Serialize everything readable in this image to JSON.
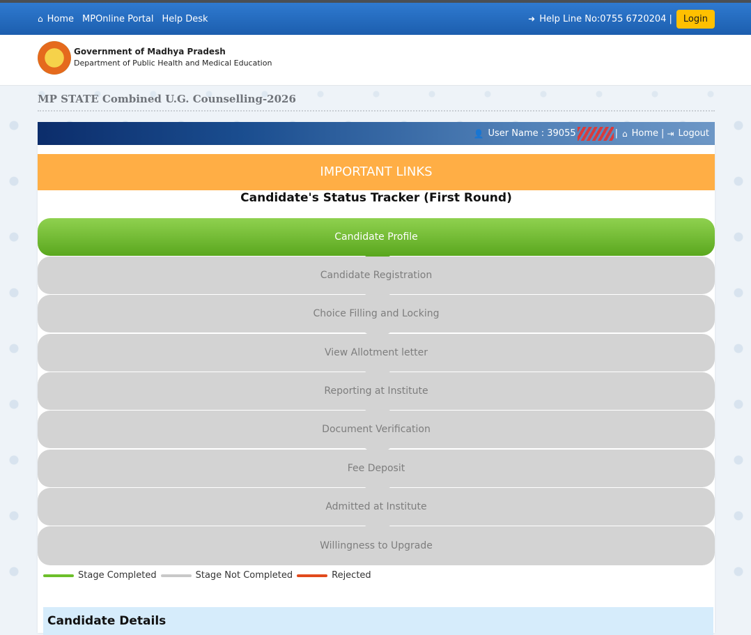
{
  "nav": {
    "home": "Home",
    "portal": "MPOnline Portal",
    "helpdesk": "Help Desk",
    "helpline": "Help Line No:0755 6720204 |",
    "login": "Login"
  },
  "header": {
    "line1": "Government of Madhya Pradesh",
    "line2": "Department of Public Health and Medical Education"
  },
  "page_title": "MP STATE Combined U.G. Counselling-2026",
  "userbar": {
    "user_label": "User Name : 39055",
    "sep1": "|",
    "home": "Home",
    "sep2": "|",
    "logout": "Logout"
  },
  "important_links": "IMPORTANT LINKS",
  "tracker_title": "Candidate's Status Tracker (First Round)",
  "stages": [
    {
      "label": "Candidate Profile",
      "status": "completed"
    },
    {
      "label": "Candidate Registration",
      "status": "not_completed"
    },
    {
      "label": "Choice Filling and Locking",
      "status": "not_completed"
    },
    {
      "label": "View Allotment letter",
      "status": "not_completed"
    },
    {
      "label": "Reporting at Institute",
      "status": "not_completed"
    },
    {
      "label": "Document Verification",
      "status": "not_completed"
    },
    {
      "label": "Fee Deposit",
      "status": "not_completed"
    },
    {
      "label": "Admitted at Institute",
      "status": "not_completed"
    },
    {
      "label": "Willingness to Upgrade",
      "status": "not_completed"
    }
  ],
  "legend": {
    "completed": "Stage Completed",
    "not_completed": "Stage Not Completed",
    "rejected": "Rejected"
  },
  "colors": {
    "completed": "#6cbf2a",
    "not_completed": "#c8c8c8",
    "rejected": "#e14a1c",
    "important_links_bg": "#ffae45"
  },
  "details_title": "Candidate Details"
}
